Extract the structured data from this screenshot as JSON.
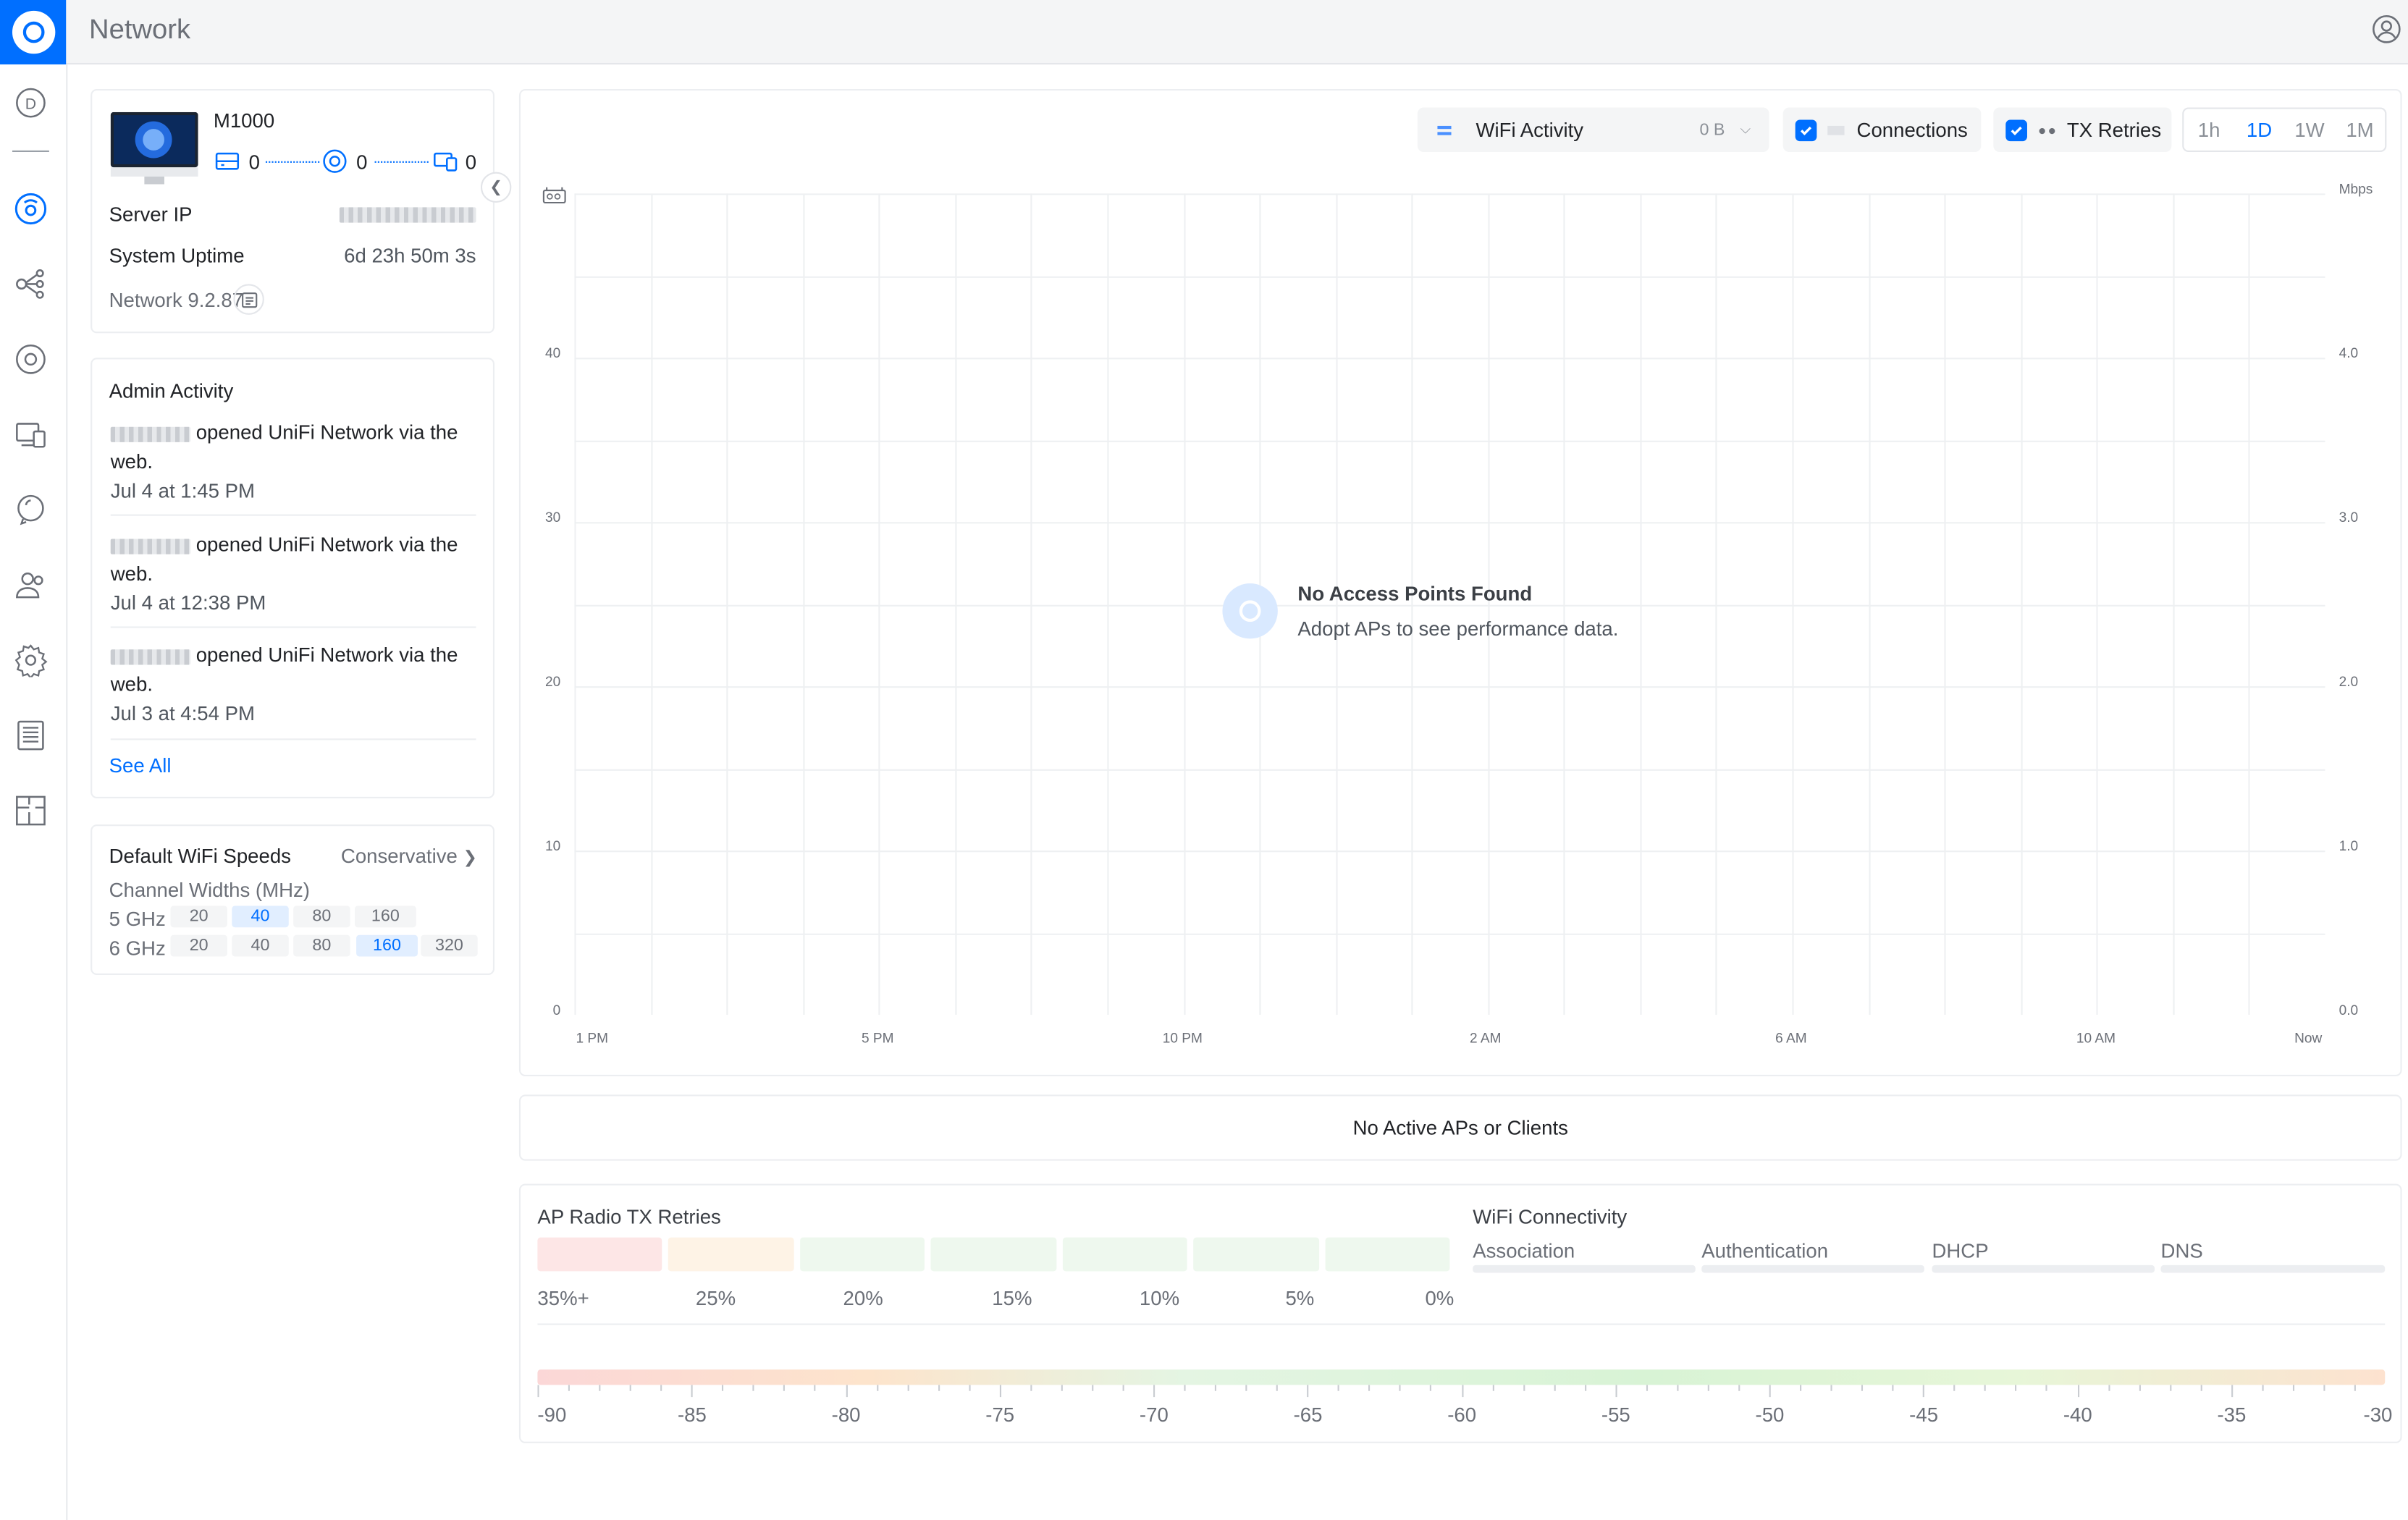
{
  "app": {
    "title": "Network"
  },
  "device": {
    "name": "M1000",
    "counts": [
      "0",
      "0",
      "0"
    ],
    "server_ip_label": "Server IP",
    "uptime_label": "System Uptime",
    "uptime_value": "6d 23h 50m 3s",
    "version": "Network 9.2.87"
  },
  "admin_activity": {
    "title": "Admin Activity",
    "items": [
      {
        "text": "opened UniFi Network via the web.",
        "time": "Jul 4 at 1:45 PM"
      },
      {
        "text": "opened UniFi Network via the web.",
        "time": "Jul 4 at 12:38 PM"
      },
      {
        "text": "opened UniFi Network via the web.",
        "time": "Jul 3 at 4:54 PM"
      }
    ],
    "see_all": "See All"
  },
  "wifi_speeds": {
    "title": "Default WiFi Speeds",
    "mode": "Conservative",
    "channel_label": "Channel Widths (MHz)",
    "rows": [
      {
        "band": "5 GHz",
        "widths": [
          "20",
          "40",
          "80",
          "160"
        ],
        "selected": "40"
      },
      {
        "band": "6 GHz",
        "widths": [
          "20",
          "40",
          "80",
          "160",
          "320"
        ],
        "selected": "160"
      }
    ]
  },
  "chart_toolbar": {
    "wifi_activity": "WiFi Activity",
    "wifi_activity_value": "0 B",
    "connections": "Connections",
    "tx_retries": "TX Retries",
    "ranges": [
      "1h",
      "1D",
      "1W",
      "1M"
    ],
    "active_range": "1D"
  },
  "chart_data": {
    "type": "line",
    "x": [
      "1 PM",
      "5 PM",
      "10 PM",
      "2 AM",
      "6 AM",
      "10 AM",
      "Now"
    ],
    "y_left_ticks": [
      "40",
      "30",
      "20",
      "10",
      "0"
    ],
    "y_right_ticks": [
      "4.0",
      "3.0",
      "2.0",
      "1.0",
      "0.0"
    ],
    "y_right_unit": "Mbps",
    "series": [],
    "empty_title": "No Access Points Found",
    "empty_subtitle": "Adopt APs to see performance data."
  },
  "no_active": "No Active APs or Clients",
  "ap_radio": {
    "title": "AP Radio TX Retries",
    "labels": [
      "35%+",
      "25%",
      "20%",
      "15%",
      "10%",
      "5%",
      "0%"
    ],
    "colors": [
      "#fde6e6",
      "#fef3e6",
      "#eef8ee",
      "#eef8ee",
      "#eef8ee",
      "#eef8ee",
      "#eef8ee"
    ]
  },
  "wifi_connectivity": {
    "title": "WiFi Connectivity",
    "stages": [
      "Association",
      "Authentication",
      "DHCP",
      "DNS"
    ]
  },
  "signal_scale": [
    "-90",
    "-85",
    "-80",
    "-75",
    "-70",
    "-65",
    "-60",
    "-55",
    "-50",
    "-45",
    "-40",
    "-35",
    "-30"
  ]
}
